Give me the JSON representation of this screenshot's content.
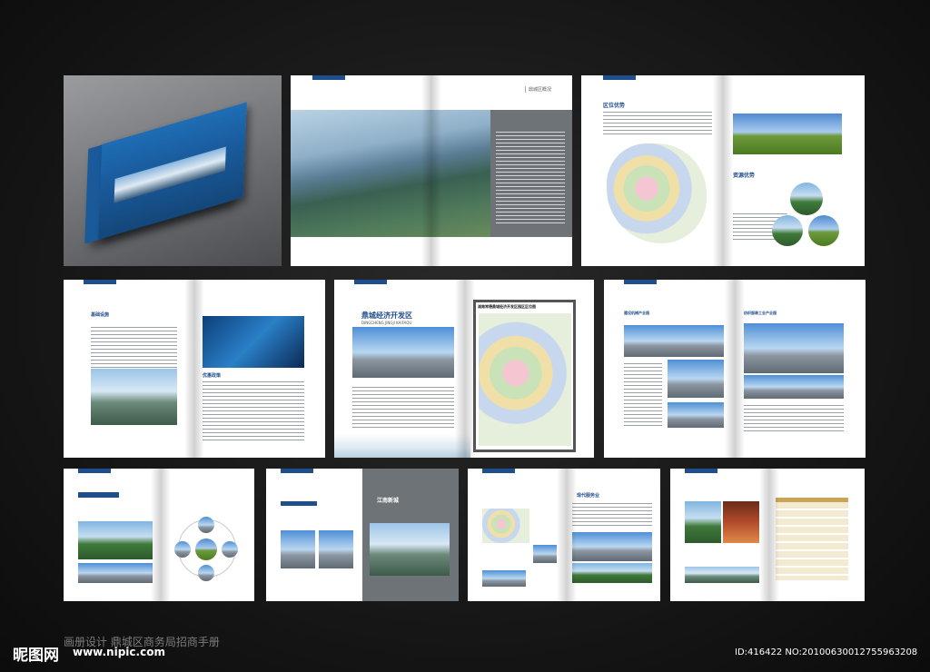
{
  "spread1": {
    "header_tag": "鼎城区概况"
  },
  "spread2": {
    "section_title": "区位优势",
    "sub_title": "资源优势"
  },
  "spread3": {
    "heading1": "基础设施",
    "heading2": "优惠政策"
  },
  "spread4": {
    "title": "鼎城经济开发区",
    "subtitle": "DINGCHENG JINGJI KAIFAQU",
    "map_title": "湖南常德鼎城经济开发区园区区位图"
  },
  "spread5": {
    "heading1": "建设机械产业园",
    "heading2": "纺织服装工业产业园"
  },
  "spread7": {
    "panel_title": "江南新城"
  },
  "spread8": {
    "heading": "现代服务业"
  },
  "watermark": {
    "site_logo": "昵图网",
    "site_url": "www.nipic.com",
    "work_title": "画册设计 鼎城区商务局招商手册",
    "image_id": "ID:416422 NO:20100630012755963208"
  }
}
